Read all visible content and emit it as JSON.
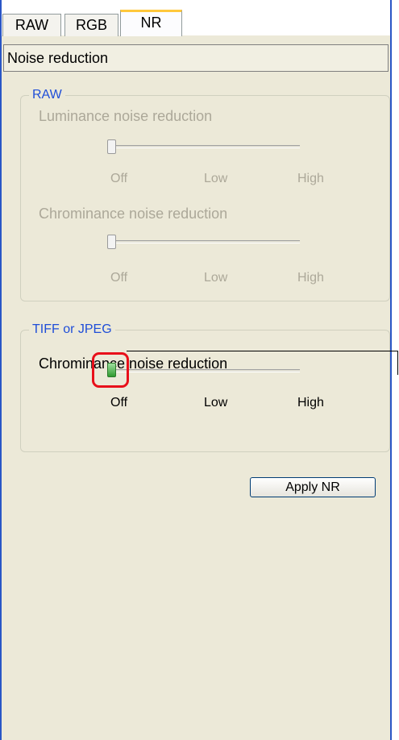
{
  "tabs": [
    {
      "label": "RAW"
    },
    {
      "label": "RGB"
    },
    {
      "label": "NR"
    }
  ],
  "header": {
    "title": "Noise reduction"
  },
  "raw_group": {
    "title": "RAW",
    "luminance": {
      "label": "Luminance noise reduction",
      "value": "Off",
      "ticks": [
        "Off",
        "Low",
        "High"
      ]
    },
    "chrominance": {
      "label": "Chrominance noise reduction",
      "value": "Off",
      "ticks": [
        "Off",
        "Low",
        "High"
      ]
    }
  },
  "tiff_group": {
    "title": "TIFF or JPEG",
    "chrominance": {
      "label": "Chrominance noise reduction",
      "value": "Off",
      "ticks": [
        "Off",
        "Low",
        "High"
      ]
    }
  },
  "apply_button": {
    "label": "Apply NR"
  },
  "colors": {
    "accent": "#1f4ed8",
    "highlight": "#e8101a",
    "active_thumb": "#2f9a2f",
    "tab_active": "#ffc83c"
  }
}
